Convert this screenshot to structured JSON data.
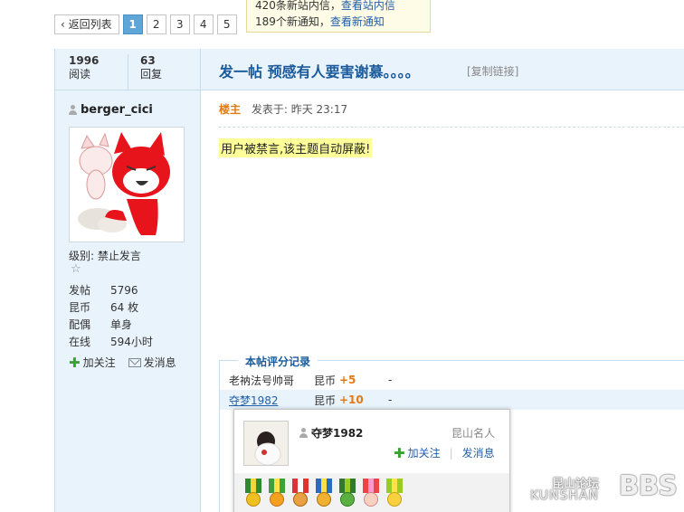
{
  "pager": {
    "back_label": "返回列表",
    "pages": [
      "1",
      "2",
      "3",
      "4",
      "5"
    ],
    "current": "1"
  },
  "notice": {
    "line1_prefix": "420条新站内信，",
    "line1_link": "查看站内信",
    "line2_prefix": "189个新通知，",
    "line2_link": "查看新通知",
    "close": "×"
  },
  "stats": {
    "views": "1996",
    "views_label": "阅读",
    "replies": "63",
    "replies_label": "回复"
  },
  "thread": {
    "title": "发一帖  预感有人要害谢慕。。。。",
    "copy_link": "[复制链接]"
  },
  "author": {
    "name": "berger_cici",
    "level": "级别: 禁止发言",
    "star": "☆",
    "info": [
      {
        "k": "发帖",
        "v": "5796"
      },
      {
        "k": "昆币",
        "v": "64 枚"
      },
      {
        "k": "配偶",
        "v": "单身"
      },
      {
        "k": "在线",
        "v": "594小时"
      }
    ],
    "follow": "加关注",
    "message": "发消息"
  },
  "post": {
    "op_label": "楼主",
    "posted": "发表于: 昨天  23:17",
    "banned_text": "用户被禁言,该主题自动屏蔽!"
  },
  "rating": {
    "title": "本帖评分记录",
    "rows": [
      {
        "user": "老衲法号帅哥",
        "currency": "昆币",
        "value": "+5",
        "note": "-"
      },
      {
        "user": "夺梦1982",
        "currency": "昆币",
        "value": "+10",
        "note": "-"
      }
    ]
  },
  "card": {
    "name": "夺梦1982",
    "rank": "昆山名人",
    "follow": "加关注",
    "divider": "|",
    "message": "发消息"
  },
  "watermark": {
    "cn": "昆山论坛",
    "en": "KUNSHAN",
    "bbs": "BBS"
  },
  "colors": {
    "accent": "#1a5a9b",
    "sidebar_bg": "#e9f3fc",
    "pager_current": "#5ea6d8",
    "highlight": "#ffff99",
    "score": "#e47a14"
  }
}
